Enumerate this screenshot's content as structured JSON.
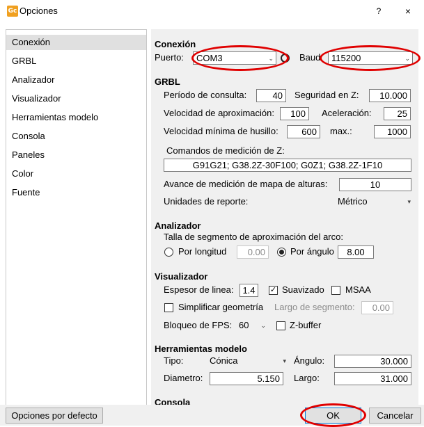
{
  "window": {
    "title": "Opciones",
    "app_icon_text": "Gc",
    "help": "?",
    "close": "×"
  },
  "sidebar": {
    "items": [
      {
        "label": "Conexión",
        "selected": true
      },
      {
        "label": "GRBL"
      },
      {
        "label": "Analizador"
      },
      {
        "label": "Visualizador"
      },
      {
        "label": "Herramientas modelo"
      },
      {
        "label": "Consola"
      },
      {
        "label": "Paneles"
      },
      {
        "label": "Color"
      },
      {
        "label": "Fuente"
      }
    ]
  },
  "conexion": {
    "header": "Conexión",
    "port_label": "Puerto:",
    "port_value": "COM3",
    "baud_label": "Baud:",
    "baud_value": "115200"
  },
  "grbl": {
    "header": "GRBL",
    "poll_label": "Período de consulta:",
    "poll_value": "40",
    "safe_z_label": "Seguridad en Z:",
    "safe_z_value": "10.000",
    "approach_label": "Velocidad de aproximación:",
    "approach_value": "100",
    "accel_label": "Aceleración:",
    "accel_value": "25",
    "spindle_min_label": "Velocidad mínima de husillo:",
    "spindle_min_value": "600",
    "max_label": "max.:",
    "max_value": "1000",
    "z_cmd_label": "Comandos de medición de Z:",
    "z_cmd_value": "G91G21; G38.2Z-30F100; G0Z1; G38.2Z-1F10",
    "heightmap_label": "Avance de medición de mapa de alturas:",
    "heightmap_value": "10",
    "units_label": "Unidades de reporte:",
    "units_value": "Métrico"
  },
  "analizador": {
    "header": "Analizador",
    "arc_label": "Talla de segmento de aproximación del arco:",
    "by_length_label": "Por longitud",
    "by_length_value": "0.00",
    "by_angle_label": "Por ángulo",
    "by_angle_value": "8.00"
  },
  "visualizador": {
    "header": "Visualizador",
    "line_width_label": "Espesor de linea:",
    "line_width_value": "1.4",
    "smoothing_label": "Suavizado",
    "smoothing_checked": true,
    "msaa_label": "MSAA",
    "msaa_checked": false,
    "simplify_label": "Simplificar geometría",
    "simplify_checked": false,
    "segment_label": "Largo de segmento:",
    "segment_value": "0.00",
    "fps_label": "Bloqueo de FPS:",
    "fps_value": "60",
    "zbuffer_label": "Z-buffer",
    "zbuffer_checked": false
  },
  "herramientas": {
    "header": "Herramientas modelo",
    "type_label": "Tipo:",
    "type_value": "Cónica",
    "angle_label": "Ángulo:",
    "angle_value": "30.000",
    "diameter_label": "Diametro:",
    "diameter_value": "5.150",
    "length_label": "Largo:",
    "length_value": "31.000"
  },
  "consola": {
    "header": "Consola"
  },
  "footer": {
    "defaults_label": "Opciones por defecto",
    "ok_label": "OK",
    "cancel_label": "Cancelar"
  },
  "icons": {
    "check_glyph": "✓",
    "arrow_glyph": "⌄",
    "small_arrow_glyph": "▾"
  },
  "colors": {
    "annotation": "#e00000",
    "selected_item": "#e0e0e0",
    "panel_bg": "#f0f0f0",
    "focus_border": "#0078d7"
  }
}
